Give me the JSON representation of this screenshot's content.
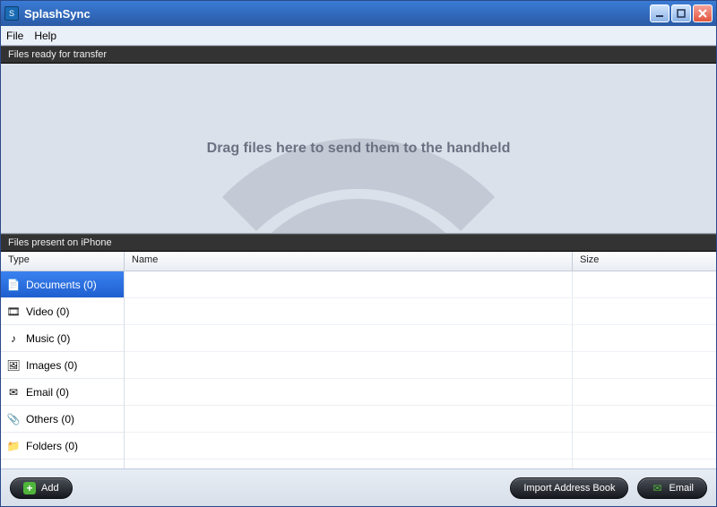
{
  "app": {
    "title": "SplashSync"
  },
  "menu": {
    "file": "File",
    "help": "Help"
  },
  "sections": {
    "transfer_header": "Files ready for transfer",
    "present_header": "Files present on iPhone",
    "drop_hint": "Drag files here to send them to the handheld"
  },
  "columns": {
    "type": "Type",
    "name": "Name",
    "size": "Size"
  },
  "types": [
    {
      "label": "Documents (0)",
      "icon": "📄",
      "selected": true
    },
    {
      "label": "Video (0)",
      "icon": "🎞",
      "selected": false
    },
    {
      "label": "Music (0)",
      "icon": "♪",
      "selected": false
    },
    {
      "label": "Images (0)",
      "icon": "🖼",
      "selected": false
    },
    {
      "label": "Email (0)",
      "icon": "✉",
      "selected": false
    },
    {
      "label": "Others (0)",
      "icon": "📎",
      "selected": false
    },
    {
      "label": "Folders (0)",
      "icon": "📁",
      "selected": false
    }
  ],
  "footer": {
    "add": "Add",
    "import_book": "Import Address Book",
    "email": "Email"
  }
}
